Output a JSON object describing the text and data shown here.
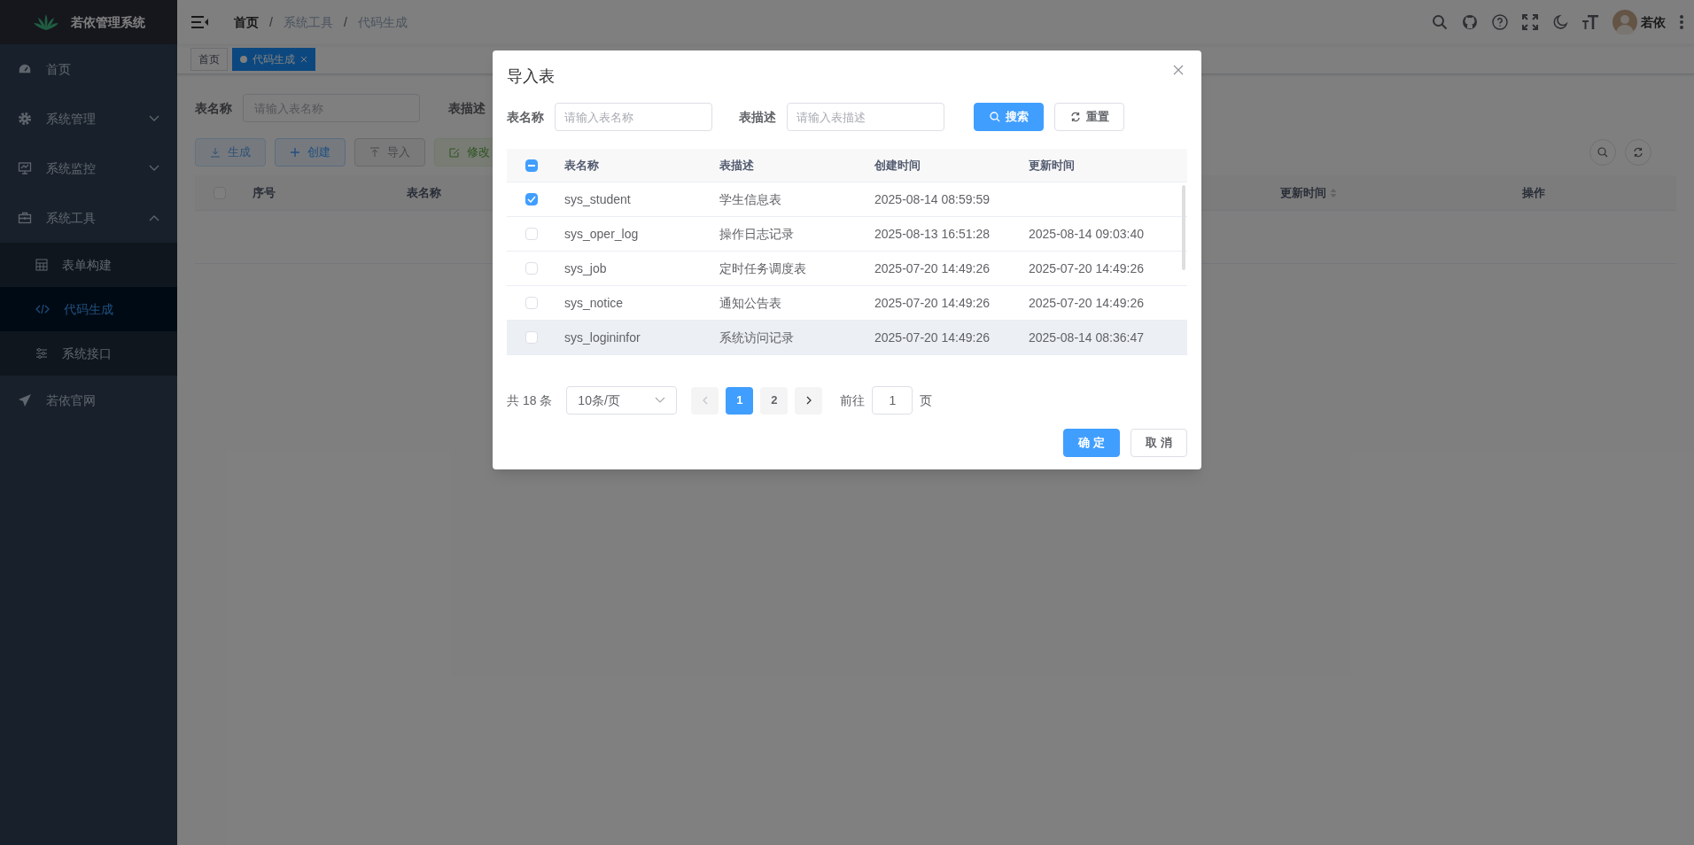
{
  "sidebar": {
    "title": "若依管理系统",
    "items": [
      {
        "label": "首页"
      },
      {
        "label": "系统管理",
        "expanded": false
      },
      {
        "label": "系统监控",
        "expanded": false
      },
      {
        "label": "系统工具",
        "expanded": true,
        "children": [
          {
            "label": "表单构建",
            "selected": false
          },
          {
            "label": "代码生成",
            "selected": true
          },
          {
            "label": "系统接口",
            "selected": false
          }
        ]
      },
      {
        "label": "若依官网"
      }
    ]
  },
  "header": {
    "breadcrumb": [
      "首页",
      "系统工具",
      "代码生成"
    ],
    "separator": "/",
    "user": "若依"
  },
  "tags": [
    {
      "label": "首页",
      "selected": false
    },
    {
      "label": "代码生成",
      "selected": true
    }
  ],
  "page": {
    "search_form": [
      {
        "label": "表名称",
        "placeholder": "请输入表名称"
      },
      {
        "label": "表描述"
      }
    ],
    "toolbar": [
      {
        "label": "生成",
        "kind": "primary",
        "disabled": true
      },
      {
        "label": "创建",
        "kind": "primary",
        "disabled": false
      },
      {
        "label": "导入",
        "kind": "info",
        "disabled": false
      },
      {
        "label": "修改",
        "kind": "success",
        "disabled": true
      }
    ],
    "table": {
      "all_checked": false,
      "columns": [
        {
          "label": "序号"
        },
        {
          "label": "表名称"
        },
        {
          "label": "更新时间",
          "sortable": true
        },
        {
          "label": "操作"
        }
      ]
    }
  },
  "dialog": {
    "title": "导入表",
    "search_form": [
      {
        "label": "表名称",
        "placeholder": "请输入表名称"
      },
      {
        "label": "表描述",
        "placeholder": "请输入表描述"
      }
    ],
    "buttons": [
      {
        "label": "搜索",
        "kind": "primary"
      },
      {
        "label": "重置",
        "kind": "default"
      }
    ],
    "table": {
      "indeterminate": true,
      "columns": [
        "表名称",
        "表描述",
        "创建时间",
        "更新时间"
      ],
      "rows": [
        {
          "checked": true,
          "hovered": false,
          "cells": [
            "sys_student",
            "学生信息表",
            "2025-08-14 08:59:59",
            ""
          ]
        },
        {
          "checked": false,
          "hovered": false,
          "cells": [
            "sys_oper_log",
            "操作日志记录",
            "2025-08-13 16:51:28",
            "2025-08-14 09:03:40"
          ]
        },
        {
          "checked": false,
          "hovered": false,
          "cells": [
            "sys_job",
            "定时任务调度表",
            "2025-07-20 14:49:26",
            "2025-07-20 14:49:26"
          ]
        },
        {
          "checked": false,
          "hovered": false,
          "cells": [
            "sys_notice",
            "通知公告表",
            "2025-07-20 14:49:26",
            "2025-07-20 14:49:26"
          ]
        },
        {
          "checked": false,
          "hovered": true,
          "cells": [
            "sys_logininfor",
            "系统访问记录",
            "2025-07-20 14:49:26",
            "2025-08-14 08:36:47"
          ]
        }
      ]
    },
    "pagination": {
      "total": "共 18 条",
      "page_size": "10条/页",
      "prev_disabled": true,
      "next_disabled": false,
      "pages": [
        {
          "label": "1",
          "selected": true
        },
        {
          "label": "2",
          "selected": false
        }
      ],
      "jump_label": "前往",
      "jump_value": "1",
      "jump_unit": "页"
    },
    "footer": [
      {
        "label": "确 定",
        "kind": "primary"
      },
      {
        "label": "取 消",
        "kind": "default"
      }
    ]
  }
}
